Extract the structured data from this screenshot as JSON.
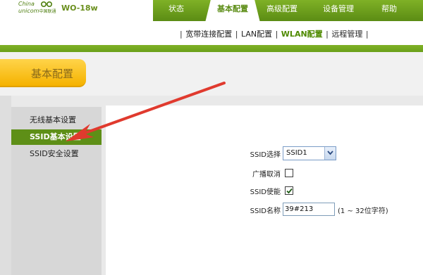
{
  "header": {
    "logo_line1": "China",
    "logo_line2": "unicom",
    "logo_line2_small": "中国联通",
    "model": "WO-18w"
  },
  "nav": {
    "items": [
      {
        "label": "状态"
      },
      {
        "label": "基本配置"
      },
      {
        "label": "高级配置"
      },
      {
        "label": "设备管理"
      },
      {
        "label": "帮助"
      }
    ],
    "active": "基本配置"
  },
  "subnav": {
    "items": [
      {
        "label": "宽带连接配置"
      },
      {
        "label": "LAN配置"
      },
      {
        "label": "WLAN配置"
      },
      {
        "label": "远程管理"
      }
    ],
    "active": "WLAN配置"
  },
  "section": {
    "title": "基本配置"
  },
  "sidebar": {
    "items": [
      {
        "label": "无线基本设置"
      },
      {
        "label": "SSID基本设置"
      },
      {
        "label": "SSID安全设置"
      }
    ],
    "active": "SSID基本设置"
  },
  "form": {
    "ssid_select": {
      "label": "SSID选择",
      "value": "SSID1"
    },
    "broadcast": {
      "label": "广播取消",
      "checked": false
    },
    "ssid_enable": {
      "label": "SSID使能",
      "checked": true
    },
    "ssid_name": {
      "label": "SSID名称",
      "value": "39#213",
      "hint": "(1 ~ 32位字符)"
    }
  },
  "colors": {
    "brand_green": "#5e8f17",
    "section_yellow": "#f5b200",
    "annotation_arrow": "#e03a2e"
  }
}
